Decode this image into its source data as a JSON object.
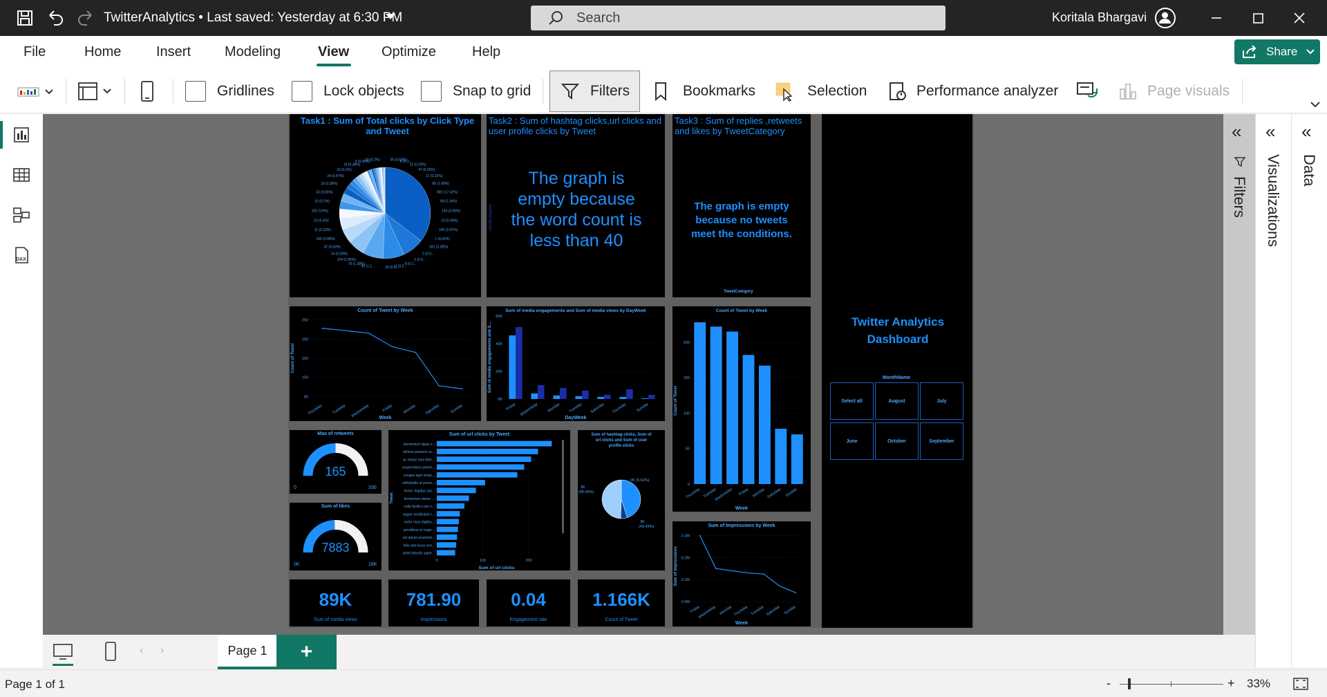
{
  "titlebar": {
    "title": "TwitterAnalytics • Last saved: Yesterday at 6:30 PM",
    "search_placeholder": "Search",
    "user_name": "Koritala Bhargavi"
  },
  "menu": {
    "items": [
      "File",
      "Home",
      "Insert",
      "Modeling",
      "View",
      "Optimize",
      "Help"
    ],
    "active": "View",
    "share_label": "Share"
  },
  "ribbon": {
    "gridlines": "Gridlines",
    "lock_objects": "Lock objects",
    "snap_to_grid": "Snap to grid",
    "filters": "Filters",
    "bookmarks": "Bookmarks",
    "selection": "Selection",
    "performance_analyzer": "Performance analyzer",
    "page_visuals": "Page visuals"
  },
  "panes": {
    "filters": "Filters",
    "visualizations": "Visualizations",
    "data": "Data"
  },
  "report": {
    "task1_title": "Task1 : Sum of Total clicks by Click Type and Tweet",
    "task1_labels": [
      "35 (0.69%)",
      "6 (0.1...",
      "11 (0.22%)",
      "47 (0.93%)",
      "11 (0.22%)",
      "85 (1.68%)",
      "881 (17.42%)",
      "68 (1.34%)",
      "104 (2.06%)",
      "23 (0.45%)",
      "145 (2.87%)",
      "1 (0.02%)",
      "181 (3.58%)",
      "2 (0.0...",
      "2 (0.0...",
      "8 (0.1...",
      "3 (0.0...",
      "33 (0.6...",
      "60 (1.1...",
      "70 (1.38%)",
      "124 (2.45%)",
      "14 (0.28%)",
      "32 (0.63%)",
      "186 (3.68%)",
      "11 (0.22%)",
      "20 (0.4%)",
      "192 (3.8%)",
      "10 (0.2%)",
      "33 (0.65%)",
      "19 (0.38%)",
      "24 (0.47%)",
      "10 (0.2%)",
      "19 (0.38%)",
      "3 (0.06%)",
      "10 (0.2%)"
    ],
    "task2_title": "Task2 : Sum of hashtag clicks,url clicks and user profile clicks by Tweet",
    "task2_axis": "TweetCategory",
    "task2_message": "The graph is empty because the word count is less than 40",
    "task3_title": "Task3 : Sum of replies ,retweets and likes by TweetCategory",
    "task3_message": "The graph is empty because no tweets meet the conditions.",
    "task3_axis": "TweetCategory",
    "dashboard_title": "Twitter Analytics Dashboard",
    "slicer_title": "MonthName",
    "slicer_options": [
      "Select all",
      "August",
      "July",
      "June",
      "October",
      "September"
    ],
    "gauge1": {
      "title": "Max of retweets",
      "value": "165",
      "min": "0",
      "max": "330",
      "fraction": 0.5
    },
    "gauge2": {
      "title": "Sum of likes",
      "value": "7883",
      "min": "0K",
      "max": "16K",
      "fraction": 0.49
    },
    "kpis": [
      {
        "value": "89K",
        "label": "Sum of media views"
      },
      {
        "value": "781.90",
        "label": "Impressions"
      },
      {
        "value": "0.04",
        "label": "Engagement rate"
      },
      {
        "value": "1.166K",
        "label": "Count of Tweet"
      }
    ],
    "donut_labels": [
      "3K (45.05%)",
      "0K (5.52%)",
      "3K (49.43%)"
    ]
  },
  "chart_data": [
    {
      "type": "line",
      "title": "Count of Tweet by Week",
      "xlabel": "Week",
      "ylabel": "Count of Tweet",
      "categories": [
        "Thursday",
        "Tuesday",
        "Wednesday",
        "Friday",
        "Monday",
        "Saturday",
        "Sunday"
      ],
      "values": [
        228,
        222,
        215,
        180,
        165,
        78,
        70
      ],
      "yticks": [
        "50",
        "100",
        "150",
        "200",
        "250"
      ],
      "ylim": [
        40,
        260
      ]
    },
    {
      "type": "bar",
      "title": "Sum of media engagements and Sum of media views by DayWeek",
      "xlabel": "DayWeek",
      "ylabel": "Sum of media engagements and S...",
      "categories": [
        "Friday",
        "Wednesday",
        "Monday",
        "Tuesday",
        "Saturday",
        "Thursday",
        "Sunday"
      ],
      "series": [
        {
          "values": [
            46000,
            4000,
            2500,
            2000,
            1500,
            1500,
            500
          ]
        },
        {
          "values": [
            52000,
            10000,
            8000,
            6000,
            3000,
            7000,
            3000
          ]
        }
      ],
      "yticks": [
        "0K",
        "20K",
        "40K",
        "60K"
      ],
      "ylim": [
        0,
        60000
      ]
    },
    {
      "type": "bar",
      "title": "Count of Tweet by Week",
      "xlabel": "Week",
      "ylabel": "Count of Tweet",
      "categories": [
        "Thursday",
        "Tuesday",
        "Wednesday",
        "Friday",
        "Monday",
        "Saturday",
        "Sunday"
      ],
      "values": [
        228,
        222,
        215,
        182,
        167,
        78,
        70
      ],
      "yticks": [
        "0",
        "50",
        "100",
        "150",
        "200"
      ],
      "ylim": [
        0,
        235
      ]
    },
    {
      "type": "bar",
      "title": "Sum of url clicks by Tweet",
      "xlabel": "Sum of url clicks",
      "ylabel": "Tweet",
      "categories": [
        "elementum ligula v...",
        "ultrices posuere cu...",
        "ac neque duis bibe...",
        "suspendisse potent...",
        "congue eget semp...",
        "sollicitudin ut suscir...",
        "donec dapibus dui...",
        "fermentum donec ...",
        "nulla facilisi cras n...",
        "augue vestibulum r...",
        "tortor risus dapibu...",
        "penatibus et magn...",
        "vel ipsum praesent...",
        "felis sed lacus mor...",
        "amet lobortis sapie..."
      ],
      "values": [
        250,
        220,
        205,
        190,
        175,
        105,
        85,
        70,
        60,
        50,
        48,
        46,
        44,
        42,
        40
      ],
      "xticks": [
        "0",
        "100",
        "200"
      ],
      "xlim": [
        0,
        260
      ]
    },
    {
      "type": "pie",
      "title": "Sum of hashtag clicks, Sum of url clicks and Sum of user profile clicks",
      "values": [
        45.05,
        5.52,
        49.43
      ]
    },
    {
      "type": "line",
      "title": "Sum of Impressions by Week",
      "xlabel": "Week",
      "ylabel": "Sum of Impressions",
      "categories": [
        "Friday",
        "Wednesday",
        "Monday",
        "Thursday",
        "Tuesday",
        "Saturday",
        "Sunday"
      ],
      "values": [
        0.3,
        0.15,
        0.14,
        0.13,
        0.125,
        0.07,
        0.04
      ],
      "yticks": [
        "0.0M",
        "0.1M",
        "0.2M",
        "0.3M"
      ],
      "ylim": [
        0,
        0.32
      ]
    }
  ]
}
